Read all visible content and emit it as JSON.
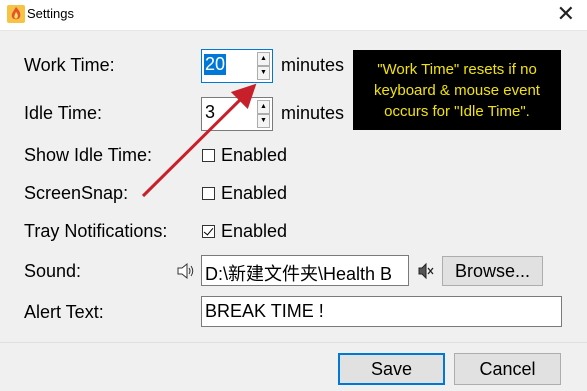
{
  "window": {
    "title": "Settings"
  },
  "fields": {
    "work_time": {
      "label": "Work Time:",
      "value": "20",
      "unit": "minutes"
    },
    "idle_time": {
      "label": "Idle Time:",
      "value": "3",
      "unit": "minutes"
    },
    "show_idle_time": {
      "label": "Show Idle Time:",
      "checkbox_label": "Enabled",
      "checked": false
    },
    "screensnap": {
      "label": "ScreenSnap:",
      "checkbox_label": "Enabled",
      "checked": false
    },
    "tray_notifications": {
      "label": "Tray Notifications:",
      "checkbox_label": "Enabled",
      "checked": true
    },
    "sound": {
      "label": "Sound:",
      "value": "D:\\新建文件夹\\Health B",
      "browse_label": "Browse..."
    },
    "alert_text": {
      "label": "Alert Text:",
      "value": "BREAK TIME !"
    }
  },
  "tooltip": {
    "line1": "\"Work Time\" resets if no",
    "line2": "keyboard & mouse event",
    "line3": "occurs for \"Idle Time\"."
  },
  "buttons": {
    "save": "Save",
    "cancel": "Cancel"
  },
  "colors": {
    "accent": "#0078d7",
    "tooltip_bg": "#000000",
    "tooltip_text": "#f2e400",
    "annotation_arrow": "#c8202a"
  },
  "icons": {
    "app": "flame-app-icon",
    "close": "close-icon",
    "sound": "speaker-icon",
    "mute": "speaker-mute-icon",
    "spin_up": "spin-up-icon",
    "spin_down": "spin-down-icon"
  }
}
